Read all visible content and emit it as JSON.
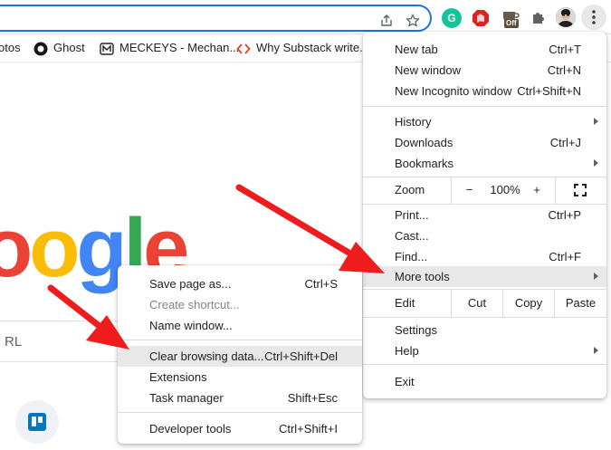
{
  "bookmarks": [
    {
      "label": "otos",
      "icon": "photos-bookmark"
    },
    {
      "label": "Ghost",
      "icon": "ghost-icon"
    },
    {
      "label": "MECKEYS - Mechan...",
      "icon": "meckeys-icon"
    },
    {
      "label": "Why Substack write...",
      "icon": "code-bracket-icon"
    }
  ],
  "extensions": {
    "grammarly_letter": "G",
    "off_badge": "Off"
  },
  "page": {
    "logo_letters": [
      "o",
      "o",
      "g",
      "l",
      "e"
    ],
    "logo_colors": [
      "#ea4335",
      "#fbbc05",
      "#4285f4",
      "#34a853",
      "#ea4335"
    ],
    "search_placeholder": "RL"
  },
  "main_menu": {
    "new_tab": {
      "label": "New tab",
      "shortcut": "Ctrl+T"
    },
    "new_window": {
      "label": "New window",
      "shortcut": "Ctrl+N"
    },
    "new_incognito": {
      "label": "New Incognito window",
      "shortcut": "Ctrl+Shift+N"
    },
    "history": {
      "label": "History"
    },
    "downloads": {
      "label": "Downloads",
      "shortcut": "Ctrl+J"
    },
    "bookmarks": {
      "label": "Bookmarks"
    },
    "zoom": {
      "label": "Zoom",
      "minus": "−",
      "value": "100%",
      "plus": "+"
    },
    "print": {
      "label": "Print...",
      "shortcut": "Ctrl+P"
    },
    "cast": {
      "label": "Cast..."
    },
    "find": {
      "label": "Find...",
      "shortcut": "Ctrl+F"
    },
    "more_tools": {
      "label": "More tools"
    },
    "edit": {
      "label": "Edit",
      "cut": "Cut",
      "copy": "Copy",
      "paste": "Paste"
    },
    "settings": {
      "label": "Settings"
    },
    "help": {
      "label": "Help"
    },
    "exit": {
      "label": "Exit"
    }
  },
  "sub_menu": {
    "save_page": {
      "label": "Save page as...",
      "shortcut": "Ctrl+S"
    },
    "create_shortcut": {
      "label": "Create shortcut..."
    },
    "name_window": {
      "label": "Name window..."
    },
    "clear_browsing": {
      "label": "Clear browsing data...",
      "shortcut": "Ctrl+Shift+Del"
    },
    "extensions": {
      "label": "Extensions"
    },
    "task_manager": {
      "label": "Task manager",
      "shortcut": "Shift+Esc"
    },
    "developer_tools": {
      "label": "Developer tools",
      "shortcut": "Ctrl+Shift+I"
    }
  },
  "colors": {
    "accent": "#1a73e8",
    "annotation_arrow": "#ee1c1c",
    "highlight": "#e8e8e9"
  }
}
